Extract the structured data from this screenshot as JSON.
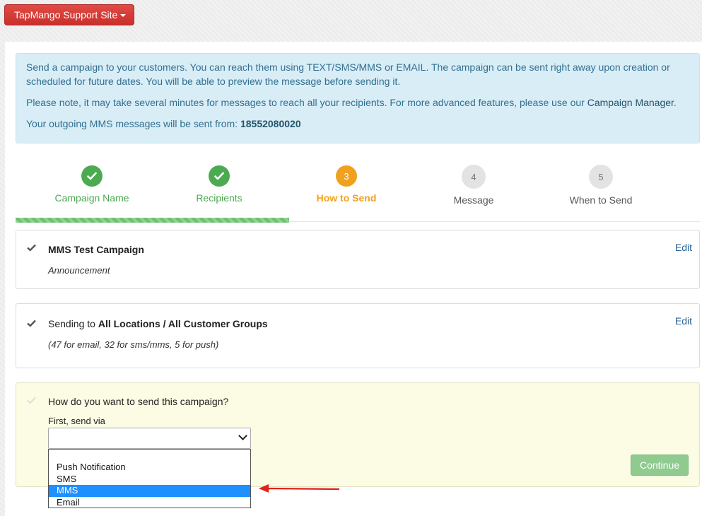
{
  "header": {
    "site_button_label": "TapMango Support Site"
  },
  "info": {
    "line1": "Send a campaign to your customers. You can reach them using TEXT/SMS/MMS or EMAIL. The campaign can be sent right away upon creation or scheduled for future dates. You will be able to preview the message before sending it.",
    "line2_prefix": "Please note, it may take several minutes for messages to reach all your recipients. For more advanced features, please use our ",
    "line2_link": "Campaign Manager",
    "line2_suffix": ".",
    "line3_prefix": "Your outgoing MMS messages will be sent from: ",
    "line3_number": "18552080020"
  },
  "steps": [
    {
      "label": "Campaign Name",
      "state": "done"
    },
    {
      "label": "Recipients",
      "state": "done"
    },
    {
      "number": "3",
      "label": "How to Send",
      "state": "active"
    },
    {
      "number": "4",
      "label": "Message",
      "state": "todo"
    },
    {
      "number": "5",
      "label": "When to Send",
      "state": "todo"
    }
  ],
  "progress_fraction": 0.4,
  "campaign_card": {
    "title": "MMS Test Campaign",
    "subtitle": "Announcement",
    "edit_label": "Edit"
  },
  "recipients_card": {
    "prefix": "Sending to ",
    "target": "All Locations / All Customer Groups",
    "counts": "(47 for email, 32 for sms/mms, 5 for push)",
    "edit_label": "Edit"
  },
  "send_card": {
    "question": "How do you want to send this campaign?",
    "field_label": "First, send via",
    "options": [
      "",
      "Push Notification",
      "SMS",
      "MMS",
      "Email"
    ],
    "highlighted_option": "MMS",
    "continue_label": "Continue"
  },
  "colors": {
    "done": "#4caa51",
    "active": "#f0a21e",
    "annotation_arrow": "#e0201b"
  },
  "icons": {
    "done_step": "check-icon",
    "card_state": "check-icon",
    "annotation": "red-arrow-icon"
  }
}
